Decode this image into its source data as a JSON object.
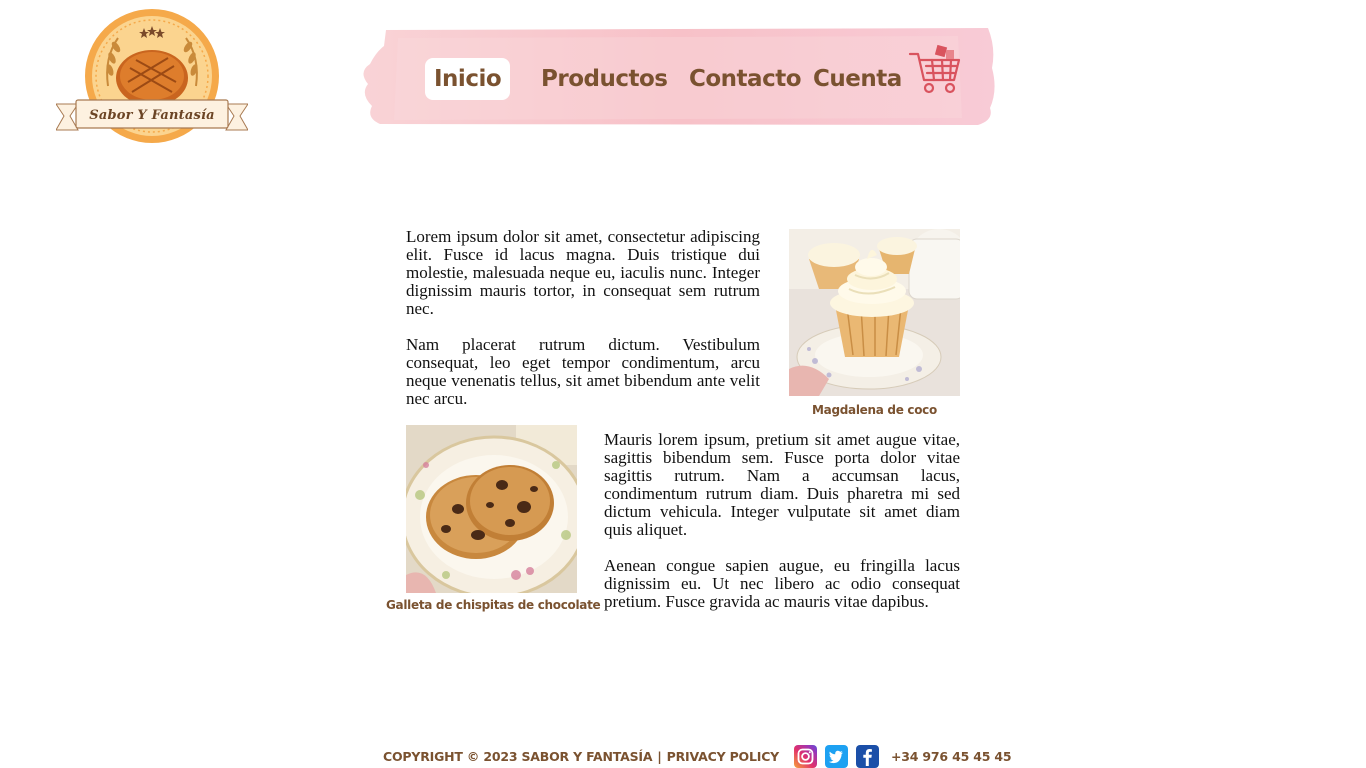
{
  "brand": {
    "name": "Sabor Y Fantasía"
  },
  "nav": {
    "items": [
      {
        "label": "Inicio",
        "active": true
      },
      {
        "label": "Productos",
        "active": false
      },
      {
        "label": "Contacto",
        "active": false
      },
      {
        "label": "Cuenta",
        "active": false
      }
    ],
    "cart_icon": "shopping-cart-icon"
  },
  "content": {
    "paragraphs": [
      "Lorem ipsum dolor sit amet, consectetur adipiscing elit. Fusce id lacus magna. Duis tristique dui molestie, malesuada neque eu, iaculis nunc. Integer dignissim mauris tortor, in consequat sem rutrum nec.",
      "Nam placerat rutrum dictum. Vestibulum consequat, leo eget tempor condimentum, arcu neque venenatis tellus, sit amet bibendum ante velit nec arcu.",
      "Mauris lorem ipsum, pretium sit amet augue vitae, sagittis bibendum sem. Fusce porta dolor vitae sagittis rutrum. Nam a accumsan lacus, condimentum rutrum diam. Duis pharetra mi sed dictum vehicula. Integer vulputate sit amet diam quis aliquet.",
      "Aenean congue sapien augue, eu fringilla lacus dignissim eu. Ut nec libero ac odio consequat pretium. Fusce gravida ac mauris vitae dapibus."
    ],
    "images": [
      {
        "caption": "Magdalena de coco"
      },
      {
        "caption": "Galleta de chispitas de chocolate"
      }
    ]
  },
  "footer": {
    "copyright": "COPYRIGHT © 2023 SABOR Y FANTASÍA",
    "separator": "|",
    "privacy": "PRIVACY POLICY",
    "social": [
      "instagram-icon",
      "twitter-icon",
      "facebook-icon"
    ],
    "phone": "+34 976 45 45 45"
  },
  "colors": {
    "brand_brown": "#7a5230",
    "nav_pink": "#f8c6cc",
    "logo_orange": "#f5a94a"
  }
}
